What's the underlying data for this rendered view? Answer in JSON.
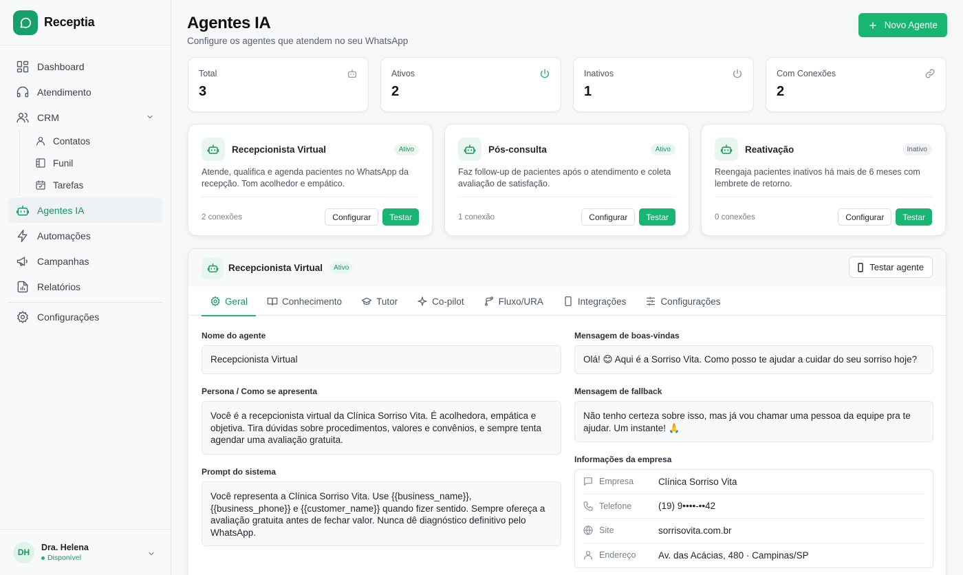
{
  "app": {
    "name": "Receptia"
  },
  "sidebar": {
    "items": [
      {
        "label": "Dashboard"
      },
      {
        "label": "Atendimento"
      },
      {
        "label": "CRM"
      },
      {
        "label": "Agentes IA"
      },
      {
        "label": "Automações"
      },
      {
        "label": "Campanhas"
      },
      {
        "label": "Relatórios"
      },
      {
        "label": "Configurações"
      }
    ],
    "crm_sub": [
      {
        "label": "Contatos"
      },
      {
        "label": "Funil"
      },
      {
        "label": "Tarefas"
      }
    ],
    "user": {
      "initials": "DH",
      "name": "Dra. Helena",
      "status": "Disponível"
    }
  },
  "header": {
    "title": "Agentes IA",
    "subtitle": "Configure os agentes que atendem no seu WhatsApp",
    "new_button": "Novo Agente"
  },
  "stats": [
    {
      "label": "Total",
      "value": "3",
      "icon": "robot-icon"
    },
    {
      "label": "Ativos",
      "value": "2",
      "icon": "power-icon"
    },
    {
      "label": "Inativos",
      "value": "1",
      "icon": "power-icon"
    },
    {
      "label": "Com Conexões",
      "value": "2",
      "icon": "link-icon"
    }
  ],
  "agents": [
    {
      "name": "Recepcionista Virtual",
      "status": "Ativo",
      "description": "Atende, qualifica e agenda pacientes no WhatsApp da recepção. Tom acolhedor e empático.",
      "connections": "2 conexões",
      "configure": "Configurar",
      "test": "Testar"
    },
    {
      "name": "Pós-consulta",
      "status": "Ativo",
      "description": "Faz follow-up de pacientes após o atendimento e coleta avaliação de satisfação.",
      "connections": "1 conexão",
      "configure": "Configurar",
      "test": "Testar"
    },
    {
      "name": "Reativação",
      "status": "Inativo",
      "description": "Reengaja pacientes inativos há mais de 6 meses com lembrete de retorno.",
      "connections": "0 conexões",
      "configure": "Configurar",
      "test": "Testar"
    }
  ],
  "detail": {
    "name": "Recepcionista Virtual",
    "status": "Ativo",
    "test_button": "Testar agente",
    "tabs": [
      {
        "label": "Geral",
        "icon": "gear-icon"
      },
      {
        "label": "Conhecimento",
        "icon": "book-icon"
      },
      {
        "label": "Tutor",
        "icon": "graduation-cap-icon"
      },
      {
        "label": "Co-pilot",
        "icon": "sparkle-icon"
      },
      {
        "label": "Fluxo/URA",
        "icon": "branch-icon"
      },
      {
        "label": "Integrações",
        "icon": "phone-icon"
      },
      {
        "label": "Configurações",
        "icon": "sliders-icon"
      }
    ],
    "form": {
      "name_label": "Nome do agente",
      "name_value": "Recepcionista Virtual",
      "persona_label": "Persona / Como se apresenta",
      "persona_value": "Você é a recepcionista virtual da Clínica Sorriso Vita. É acolhedora, empática e objetiva. Tira dúvidas sobre procedimentos, valores e convênios, e sempre tenta agendar uma avaliação gratuita.",
      "prompt_label": "Prompt do sistema",
      "prompt_value": "Você representa a Clínica Sorriso Vita. Use {{business_name}}, {{business_phone}} e {{customer_name}} quando fizer sentido. Sempre ofereça a avaliação gratuita antes de fechar valor. Nunca dê diagnóstico definitivo pelo WhatsApp.",
      "welcome_label": "Mensagem de boas-vindas",
      "welcome_value": "Olá! 😊 Aqui é a Sorriso Vita. Como posso te ajudar a cuidar do seu sorriso hoje?",
      "fallback_label": "Mensagem de fallback",
      "fallback_value": "Não tenho certeza sobre isso, mas já vou chamar uma pessoa da equipe pra te ajudar. Um instante! 🙏",
      "company_label": "Informações da empresa",
      "company": [
        {
          "key": "Empresa",
          "value": "Clínica Sorriso Vita",
          "icon": "chat-icon"
        },
        {
          "key": "Telefone",
          "value": "(19) 9••••-••42",
          "icon": "phone-icon"
        },
        {
          "key": "Site",
          "value": "sorrisovita.com.br",
          "icon": "globe-icon"
        },
        {
          "key": "Endereço",
          "value": "Av. das Acácias, 480 · Campinas/SP",
          "icon": "person-icon"
        }
      ]
    }
  },
  "colors": {
    "accent": "#19b573",
    "accent_dark": "#15955f"
  }
}
